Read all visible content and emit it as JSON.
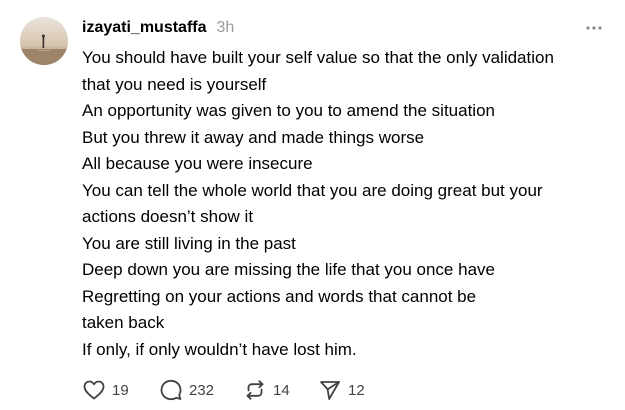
{
  "post": {
    "author": "izayati_mustaffa",
    "time_ago": "3h",
    "more_icon": "more-horizontal-icon",
    "lines": [
      "You should have built your self value so that the only validation",
      "that you need is yourself",
      "An opportunity was given to you to amend the situation",
      "But you threw it away and made things worse",
      "All because you were insecure",
      "You can tell the whole world that you are doing great but your",
      "actions doesn’t show it",
      "You are still living in the past",
      "Deep down you are missing the life that you once have",
      "Regretting on your actions and words that cannot be",
      "taken back",
      "If only, if only wouldn’t have lost him."
    ]
  },
  "actions": {
    "like": {
      "icon": "heart-icon",
      "count": "19"
    },
    "reply": {
      "icon": "comment-icon",
      "count": "232"
    },
    "repost": {
      "icon": "repost-icon",
      "count": "14"
    },
    "share": {
      "icon": "send-icon",
      "count": "12"
    }
  },
  "colors": {
    "text": "#000000",
    "muted": "#999999",
    "icon": "#424242"
  }
}
